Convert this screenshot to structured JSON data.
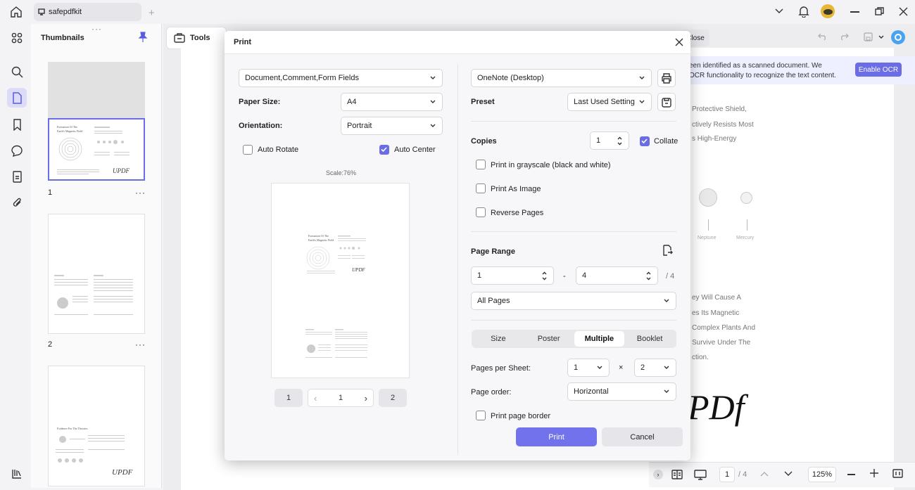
{
  "window": {
    "tab_title": "safepdfkit",
    "colors": {
      "accent": "#6b6de6",
      "print_button": "#7273ec"
    }
  },
  "sidebar": {
    "title": "Thumbnails",
    "pages": [
      {
        "number": "1",
        "more": "···"
      },
      {
        "number": "2",
        "more": "···"
      }
    ],
    "thumb1": {
      "title_line1": "Formation Of The",
      "title_line2": "Earth's Magnetic Field",
      "signature": "UPDF"
    },
    "thumb3": {
      "title": "Evidence For The Theories",
      "signature": "UPDF"
    }
  },
  "toolbar": {
    "tools_label": "Tools",
    "close_label": "Close"
  },
  "ocr_banner": {
    "text_line1": "een identified as a scanned document. We",
    "text_line2": "OCR functionality to recognize the text content.",
    "button": "Enable OCR"
  },
  "document": {
    "lines_top": [
      "Protective Shield,",
      "ctively Resists Most",
      "s High-Energy"
    ],
    "planet_labels": [
      "Neptune",
      "Mercury"
    ],
    "lines_bottom": [
      "ey Will Cause A",
      "es Its Magnetic",
      "Complex Plants And",
      "Survive Under The",
      "ction."
    ],
    "signature": "PDf"
  },
  "dialog": {
    "title": "Print",
    "content_select": "Document,Comment,Form Fields",
    "paper_size_label": "Paper Size:",
    "paper_size": "A4",
    "orientation_label": "Orientation:",
    "orientation": "Portrait",
    "auto_rotate_label": "Auto Rotate",
    "auto_rotate": false,
    "auto_center_label": "Auto Center",
    "auto_center": true,
    "scale": "Scale:76%",
    "preview": {
      "page1_title_line1": "Formation Of The",
      "page1_title_line2": "Earth's Magnetic Field",
      "signature": "UPDF"
    },
    "pager": {
      "first": "1",
      "current": "1",
      "last": "2"
    },
    "printer": "OneNote (Desktop)",
    "preset_label": "Preset",
    "preset": "Last Used Setting",
    "copies_label": "Copies",
    "copies": "1",
    "collate_label": "Collate",
    "collate": true,
    "grayscale_label": "Print in grayscale (black and white)",
    "as_image_label": "Print As Image",
    "reverse_label": "Reverse Pages",
    "page_range_label": "Page Range",
    "range_from": "1",
    "range_dash": "-",
    "range_to": "4",
    "range_total": "/ 4",
    "pages_select": "All Pages",
    "modes": [
      "Size",
      "Poster",
      "Multiple",
      "Booklet"
    ],
    "active_mode": "Multiple",
    "pages_per_sheet_label": "Pages per Sheet:",
    "per_sheet_a": "1",
    "times": "×",
    "per_sheet_b": "2",
    "page_order_label": "Page order:",
    "page_order": "Horizontal",
    "border_label": "Print page border",
    "print_button": "Print",
    "cancel_button": "Cancel"
  },
  "statusbar": {
    "page": "1",
    "total": "/ 4",
    "zoom": "125%"
  }
}
